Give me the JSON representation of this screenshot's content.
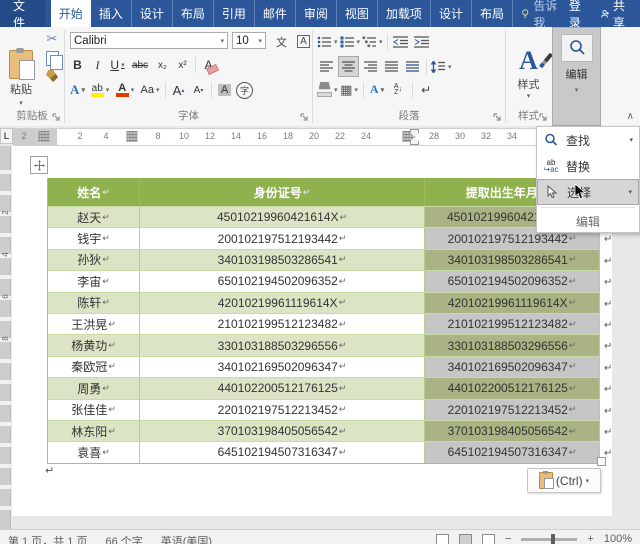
{
  "tabbar": {
    "file": "文件",
    "tabs": [
      {
        "label": "开始",
        "active": true
      },
      {
        "label": "插入"
      },
      {
        "label": "设计"
      },
      {
        "label": "布局"
      },
      {
        "label": "引用"
      },
      {
        "label": "邮件"
      },
      {
        "label": "审阅"
      },
      {
        "label": "视图"
      },
      {
        "label": "加载项"
      },
      {
        "label": "设计"
      },
      {
        "label": "布局"
      }
    ],
    "tell_me": "告诉我",
    "sign_in": "登录",
    "share": "共享"
  },
  "ribbon": {
    "clipboard": {
      "paste": "粘贴",
      "label": "剪贴板"
    },
    "font": {
      "family": "Calibri",
      "size": "10",
      "bold": "B",
      "italic": "I",
      "underline": "U",
      "strikethrough": "abc",
      "subscript": "x₂",
      "superscript": "x²",
      "clear_format": "A",
      "text_effects": "A",
      "highlight": "ab",
      "font_color": "A",
      "change_case": "Aa",
      "grow": "A",
      "shrink": "A",
      "char_shading": "A",
      "enclose": "字",
      "phonetic": "文",
      "char_border": "A",
      "label": "字体"
    },
    "paragraph": {
      "sort_a": "A",
      "sort_z": "Z",
      "sort_arrow": "↓",
      "mark": "↵",
      "label": "段落"
    },
    "styles": {
      "icon_letter": "A",
      "button": "样式",
      "label": "样式"
    },
    "editing": {
      "button": "编辑"
    },
    "collapse": "∧"
  },
  "ruler": {
    "corner": "L",
    "margin_tick": "2",
    "ticks": [
      "2",
      "4",
      "8",
      "10",
      "12",
      "14",
      "16",
      "18",
      "20",
      "22",
      "24",
      "28",
      "30",
      "32",
      "34"
    ],
    "vticks": [
      "2",
      "4",
      "6",
      "8"
    ]
  },
  "table": {
    "headers": [
      "姓名",
      "身份证号",
      "提取出生年月日"
    ],
    "eol": "↵",
    "rows": [
      {
        "name": "赵天",
        "id": "45010219960421614X",
        "extract": "45010219960421614X"
      },
      {
        "name": "钱宇",
        "id": "200102197512193442",
        "extract": "200102197512193442"
      },
      {
        "name": "孙狄",
        "id": "340103198503286541",
        "extract": "340103198503286541"
      },
      {
        "name": "李宙",
        "id": "650102194502096352",
        "extract": "650102194502096352"
      },
      {
        "name": "陈轩",
        "id": "42010219961119614X",
        "extract": "42010219961119614X"
      },
      {
        "name": "王洪晃",
        "id": "210102199512123482",
        "extract": "210102199512123482"
      },
      {
        "name": "杨黄功",
        "id": "330103188503296556",
        "extract": "330103188503296556"
      },
      {
        "name": "秦欧冠",
        "id": "340102169502096347",
        "extract": "340102169502096347"
      },
      {
        "name": "周勇",
        "id": "440102200512176125",
        "extract": "440102200512176125"
      },
      {
        "name": "张佳佳",
        "id": "220102197512213452",
        "extract": "220102197512213452"
      },
      {
        "name": "林东阳",
        "id": "370103198405056542",
        "extract": "370103198405056542"
      },
      {
        "name": "袁喜",
        "id": "645102194507316347",
        "extract": "645102194507316347"
      }
    ]
  },
  "menu": {
    "find": "查找",
    "replace": "替换",
    "select": "选择",
    "footer": "编辑"
  },
  "paste_options": {
    "label": "(Ctrl)"
  },
  "statusbar": {
    "pages": "第 1 页，共 1 页",
    "words": "66 个字",
    "language": "英语(美国)",
    "zoom": "100%"
  },
  "colors": {
    "accent": "#2B579A",
    "table_header_green": "#8FB14E",
    "row_green": "#DBE5C5",
    "selection_gray": "#C6C6C6",
    "selection_olive": "#A9B383"
  }
}
